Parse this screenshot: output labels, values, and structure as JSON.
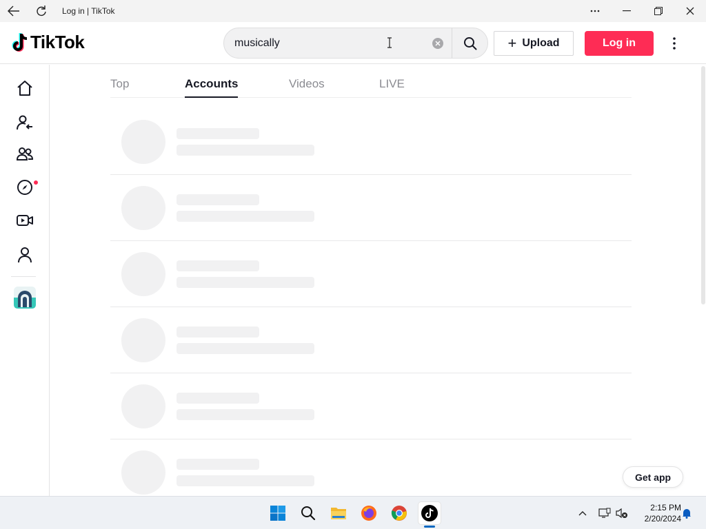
{
  "window": {
    "title": "Log in | TikTok",
    "back_icon": "arrow-left-icon",
    "refresh_icon": "refresh-icon",
    "more_icon": "ellipsis-icon",
    "minimize_icon": "minimize-icon",
    "restore_icon": "restore-icon",
    "close_icon": "close-icon"
  },
  "header": {
    "logo_text": "TikTok",
    "search": {
      "value": "musically",
      "placeholder": "Search"
    },
    "upload_label": "Upload",
    "login_label": "Log in"
  },
  "sidebar": {
    "items": [
      {
        "icon": "home-icon"
      },
      {
        "icon": "following-icon"
      },
      {
        "icon": "friends-icon"
      },
      {
        "icon": "explore-icon",
        "has_notification": true
      },
      {
        "icon": "live-icon"
      },
      {
        "icon": "profile-icon"
      }
    ]
  },
  "tabs": [
    {
      "label": "Top",
      "active": false
    },
    {
      "label": "Accounts",
      "active": true
    },
    {
      "label": "Videos",
      "active": false
    },
    {
      "label": "LIVE",
      "active": false
    }
  ],
  "results": {
    "loading_placeholders": 6
  },
  "get_app_label": "Get app",
  "taskbar": {
    "apps": [
      "windows-start-icon",
      "search-icon",
      "file-explorer-icon",
      "firefox-icon",
      "chrome-icon",
      "tiktok-icon"
    ],
    "active_app": "tiktok-icon",
    "time": "2:15 PM",
    "date": "2/20/2024"
  },
  "colors": {
    "accent": "#fe2c55",
    "text": "#161823",
    "muted": "#8a8b91",
    "skeleton": "#f1f1f2"
  }
}
